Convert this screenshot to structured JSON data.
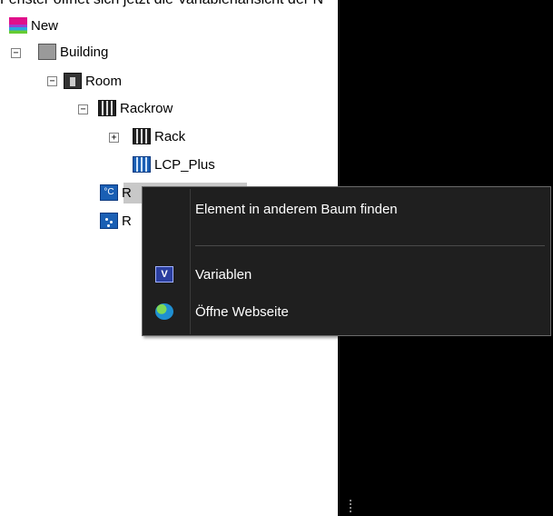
{
  "caption": "Fenster öffnet sich jetzt die Variablenansicht der N",
  "tree": {
    "nodes": [
      {
        "label": "New",
        "icon": "new-icon",
        "expander": ""
      },
      {
        "label": "Building",
        "icon": "building-icon",
        "expander": "−"
      },
      {
        "label": "Room",
        "icon": "room-icon",
        "expander": "−"
      },
      {
        "label": "Rackrow",
        "icon": "rackrow-icon",
        "expander": "−"
      },
      {
        "label": "Rack",
        "icon": "rack-icon",
        "expander": "+"
      },
      {
        "label": "LCP_Plus",
        "icon": "lcp-icon",
        "expander": ""
      },
      {
        "label": "R",
        "icon": "temperature-sensor-icon",
        "expander": ""
      },
      {
        "label": "R",
        "icon": "humidity-sensor-icon",
        "expander": ""
      }
    ],
    "temp_icon_text": "°C"
  },
  "context_menu": {
    "find_in_tree": "Element in anderem Baum finden",
    "variables": "Variablen",
    "variables_icon_text": "V",
    "open_website": "Öffne Webseite"
  },
  "colors": {
    "menu_bg": "#1f1f1f",
    "right_panel": "#000000",
    "selection": "#c8c8c8"
  }
}
